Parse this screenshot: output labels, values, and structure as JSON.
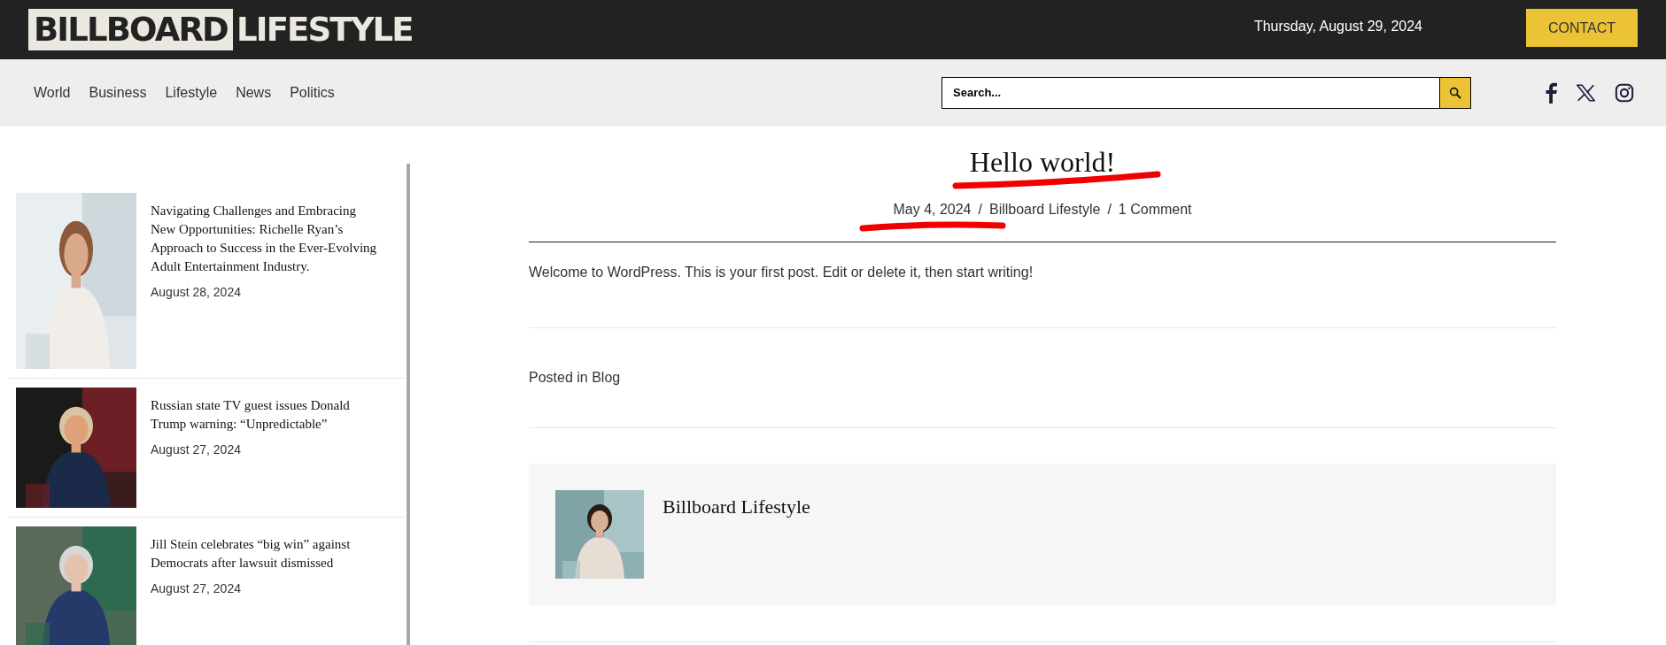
{
  "header": {
    "logo": {
      "boxed": "BILLBOARD",
      "plain": "LIFESTYLE"
    },
    "date": "Thursday, August 29, 2024",
    "contact_button": "CONTACT"
  },
  "nav": {
    "items": [
      "World",
      "Business",
      "Lifestyle",
      "News",
      "Politics"
    ],
    "search": {
      "placeholder": "Search..."
    }
  },
  "sidebar": {
    "posts": [
      {
        "title": "Navigating Challenges and Embracing New Opportunities: Richelle Ryan’s Approach to Success in the Ever-Evolving Adult Entertainment Industry.",
        "date": "August 28, 2024"
      },
      {
        "title": "Russian state TV guest issues Donald Trump warning: “Unpredictable”",
        "date": "August 27, 2024"
      },
      {
        "title": "Jill Stein celebrates “big win” against Democrats after lawsuit dismissed",
        "date": "August 27, 2024"
      }
    ]
  },
  "post": {
    "title": "Hello world!",
    "meta": [
      "May 4, 2024",
      "Billboard Lifestyle",
      "1 Comment"
    ],
    "meta_separator": "/",
    "body": "Welcome to WordPress. This is your first post. Edit or delete it, then start writing!",
    "posted_in": {
      "label": "Posted in",
      "category": "Blog"
    },
    "author": {
      "name": "Billboard Lifestyle"
    }
  }
}
